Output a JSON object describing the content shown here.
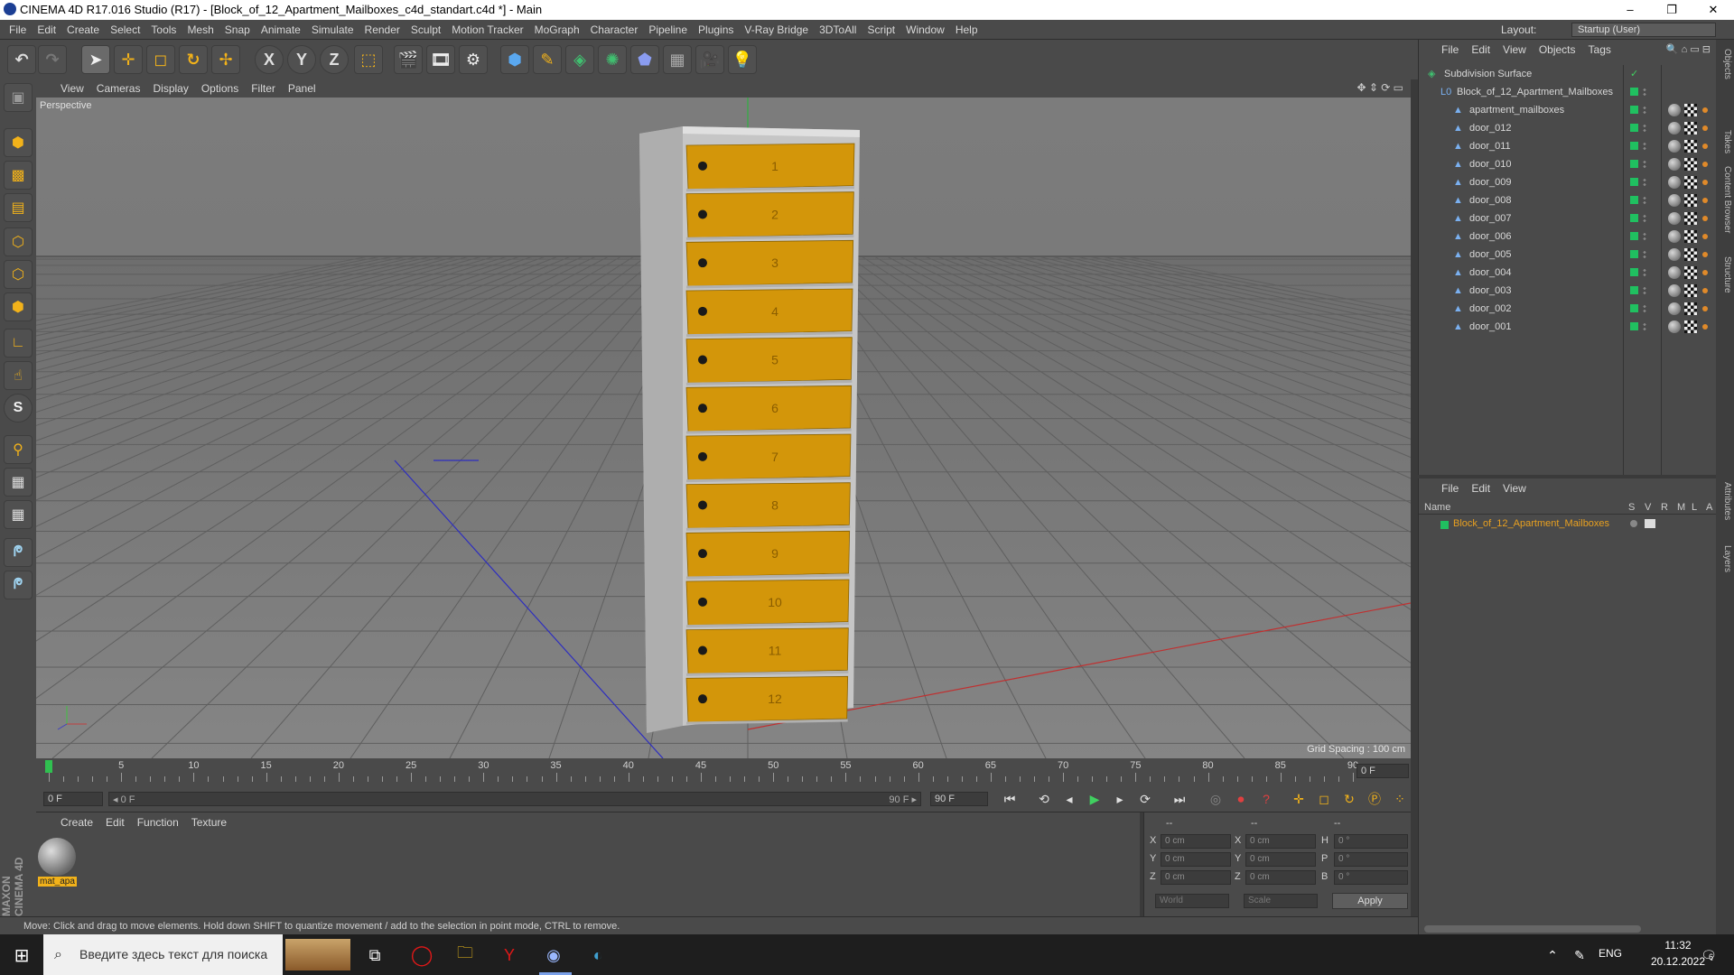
{
  "window": {
    "title": "CINEMA 4D R17.016 Studio (R17) - [Block_of_12_Apartment_Mailboxes_c4d_standart.c4d *] - Main",
    "minimize": "–",
    "restore": "❐",
    "close": "✕"
  },
  "menu": [
    "File",
    "Edit",
    "Create",
    "Select",
    "Tools",
    "Mesh",
    "Snap",
    "Animate",
    "Simulate",
    "Render",
    "Sculpt",
    "Motion Tracker",
    "MoGraph",
    "Character",
    "Pipeline",
    "Plugins",
    "V-Ray Bridge",
    "3DToAll",
    "Script",
    "Window",
    "Help"
  ],
  "layout": {
    "label": "Layout:",
    "value": "Startup (User)"
  },
  "toolbar": {
    "x": "X",
    "y": "Y",
    "z": "Z"
  },
  "viewport": {
    "menu": [
      "View",
      "Cameras",
      "Display",
      "Options",
      "Filter",
      "Panel"
    ],
    "label": "Perspective",
    "grid_spacing": "Grid Spacing : 100 cm",
    "door_numbers": [
      "1",
      "2",
      "3",
      "4",
      "5",
      "6",
      "7",
      "8",
      "9",
      "10",
      "11",
      "12"
    ]
  },
  "timeline": {
    "ticks": [
      "0",
      "5",
      "10",
      "15",
      "20",
      "25",
      "30",
      "35",
      "40",
      "45",
      "50",
      "55",
      "60",
      "65",
      "70",
      "75",
      "80",
      "85",
      "90"
    ],
    "frame_right": "0 F",
    "start": "0 F",
    "slider_start": "◂ 0 F",
    "slider_end": "90 F ▸",
    "end": "90 F"
  },
  "materials": {
    "menu": [
      "Create",
      "Edit",
      "Function",
      "Texture"
    ],
    "items": [
      {
        "name": "mat_apa"
      }
    ]
  },
  "coords": {
    "head": [
      "--",
      "--",
      "--"
    ],
    "rows": [
      {
        "a": "X",
        "v1": "0 cm",
        "b": "X",
        "v2": "0 cm",
        "c": "H",
        "v3": "0 °"
      },
      {
        "a": "Y",
        "v1": "0 cm",
        "b": "Y",
        "v2": "0 cm",
        "c": "P",
        "v3": "0 °"
      },
      {
        "a": "Z",
        "v1": "0 cm",
        "b": "Z",
        "v2": "0 cm",
        "c": "B",
        "v3": "0 °"
      }
    ],
    "world": "World",
    "scale": "Scale",
    "apply": "Apply"
  },
  "status": "Move: Click and drag to move elements. Hold down SHIFT to quantize movement / add to the selection in point mode, CTRL to remove.",
  "objects": {
    "menu": [
      "File",
      "Edit",
      "View",
      "Objects",
      "Tags"
    ],
    "tree": [
      {
        "name": "Subdivision Surface",
        "level": 0
      },
      {
        "name": "Block_of_12_Apartment_Mailboxes",
        "level": 1
      },
      {
        "name": "apartment_mailboxes",
        "level": 2
      },
      {
        "name": "door_012",
        "level": 2
      },
      {
        "name": "door_011",
        "level": 2
      },
      {
        "name": "door_010",
        "level": 2
      },
      {
        "name": "door_009",
        "level": 2
      },
      {
        "name": "door_008",
        "level": 2
      },
      {
        "name": "door_007",
        "level": 2
      },
      {
        "name": "door_006",
        "level": 2
      },
      {
        "name": "door_005",
        "level": 2
      },
      {
        "name": "door_004",
        "level": 2
      },
      {
        "name": "door_003",
        "level": 2
      },
      {
        "name": "door_002",
        "level": 2
      },
      {
        "name": "door_001",
        "level": 2
      }
    ]
  },
  "layers": {
    "menu": [
      "File",
      "Edit",
      "View"
    ],
    "columns": {
      "name": "Name",
      "s": "S",
      "v": "V",
      "r": "R",
      "m": "M",
      "l": "L",
      "a": "A"
    },
    "items": [
      {
        "name": "Block_of_12_Apartment_Mailboxes"
      }
    ]
  },
  "vtabs": [
    "Objects",
    "Takes",
    "Content Browser",
    "Structure",
    "Attributes",
    "Layers"
  ],
  "taskbar": {
    "search": "Введите здесь текст для поиска",
    "lang": "ENG",
    "time": "11:32",
    "date": "20.12.2022",
    "notif": "6"
  },
  "colors": {
    "door": "#d3960a",
    "accent_green": "#20c060",
    "layer_orange": "#e08a2a",
    "bg": "#4a4a4a"
  }
}
